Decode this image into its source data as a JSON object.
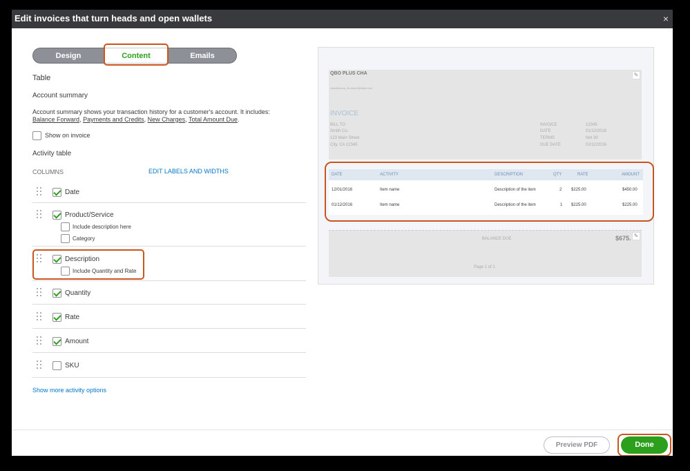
{
  "window": {
    "title": "Edit invoices that turn heads and open wallets",
    "close_icon": "×"
  },
  "tabs": [
    {
      "label": "Design",
      "active": false
    },
    {
      "label": "Content",
      "active": true
    },
    {
      "label": "Emails",
      "active": false
    }
  ],
  "section": {
    "title": "Table",
    "account_summary": {
      "heading": "Account summary",
      "description_prefix": "Account summary shows your transaction history for a customer's account. It includes:",
      "items": [
        "Balance Forward",
        "Payments and Credits",
        "New Charges",
        "Total Amount Due"
      ],
      "show_on_invoice": {
        "label": "Show on invoice",
        "checked": false
      }
    },
    "activity_table": {
      "heading": "Activity table",
      "columns_label": "COLUMNS",
      "edit_link": "EDIT LABELS AND WIDTHS",
      "columns": [
        {
          "label": "Date",
          "checked": true
        },
        {
          "label": "Product/Service",
          "checked": true,
          "sub": [
            {
              "label": "Include description here",
              "checked": false
            },
            {
              "label": "Category",
              "checked": false
            }
          ]
        },
        {
          "label": "Description",
          "checked": true,
          "sub": [
            {
              "label": "Include Quantity and Rate",
              "checked": false
            }
          ]
        },
        {
          "label": "Quantity",
          "checked": true
        },
        {
          "label": "Rate",
          "checked": true
        },
        {
          "label": "Amount",
          "checked": true
        },
        {
          "label": "SKU",
          "checked": false
        }
      ],
      "more_link": "Show more activity options"
    }
  },
  "preview": {
    "company": "QBO PLUS CHA",
    "email": "charlesmoss_fb.winter@intuit.com",
    "doc_title": "INVOICE",
    "bill_to": {
      "label": "BILL TO",
      "lines": [
        "Smith Co.",
        "123 Main Street",
        "City, CA 12345"
      ]
    },
    "meta": [
      {
        "label": "INVOICE",
        "value": "12345"
      },
      {
        "label": "DATE",
        "value": "01/12/2016"
      },
      {
        "label": "TERMS",
        "value": "Net 30"
      },
      {
        "label": "DUE DATE",
        "value": "02/12/2016"
      }
    ],
    "table": {
      "headers": [
        "DATE",
        "ACTIVITY",
        "DESCRIPTION",
        "QTY",
        "RATE",
        "AMOUNT"
      ],
      "rows": [
        {
          "date": "12/01/2016",
          "activity": "Item name",
          "description": "Description of the item",
          "qty": "2",
          "rate": "$225.00",
          "amount": "$450.00"
        },
        {
          "date": "01/12/2016",
          "activity": "Item name",
          "description": "Description of the item",
          "qty": "1",
          "rate": "$225.00",
          "amount": "$225.00"
        }
      ]
    },
    "balance_due_label": "BALANCE DUE",
    "balance_due_value": "$675.",
    "page_label": "Page 1 of 1"
  },
  "footer": {
    "preview_pdf": "Preview PDF",
    "done": "Done"
  },
  "colors": {
    "accent": "#2ca01c",
    "highlight": "#c9541e",
    "link": "#0077c5",
    "titlebar": "#393a3d"
  }
}
